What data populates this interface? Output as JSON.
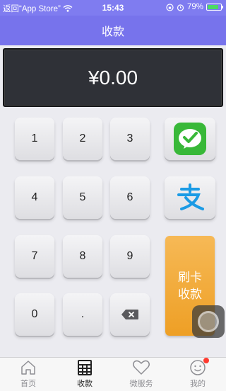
{
  "statusbar": {
    "back_label": "返回“App Store”",
    "time": "15:43",
    "battery": "79%",
    "icons": [
      "signal-icon",
      "wifi-icon",
      "alarm-icon",
      "lock-rotation-icon",
      "battery-icon"
    ]
  },
  "navbar": {
    "title": "收款"
  },
  "display": {
    "amount": "¥0.00"
  },
  "keypad": {
    "k1": "1",
    "k2": "2",
    "k3": "3",
    "k4": "4",
    "k5": "5",
    "k6": "6",
    "k7": "7",
    "k8": "8",
    "k9": "9",
    "k0": "0",
    "kdot": "."
  },
  "payment": {
    "wechat_icon": "wechat-pay-icon",
    "alipay_icon": "alipay-icon",
    "card_line1": "刷卡",
    "card_line2": "收款"
  },
  "tabbar": {
    "tabs": [
      {
        "label": "首页",
        "icon": "home-icon"
      },
      {
        "label": "收款",
        "icon": "calculator-icon"
      },
      {
        "label": "微服务",
        "icon": "heart-icon"
      },
      {
        "label": "我的",
        "icon": "profile-smile-icon"
      }
    ],
    "active": "收款"
  },
  "colors": {
    "header": "#7773ec",
    "display_bg": "#2f3137",
    "card_button": "#f0a42b",
    "wechat_green": "#38b838",
    "alipay_blue": "#1b9be5"
  }
}
